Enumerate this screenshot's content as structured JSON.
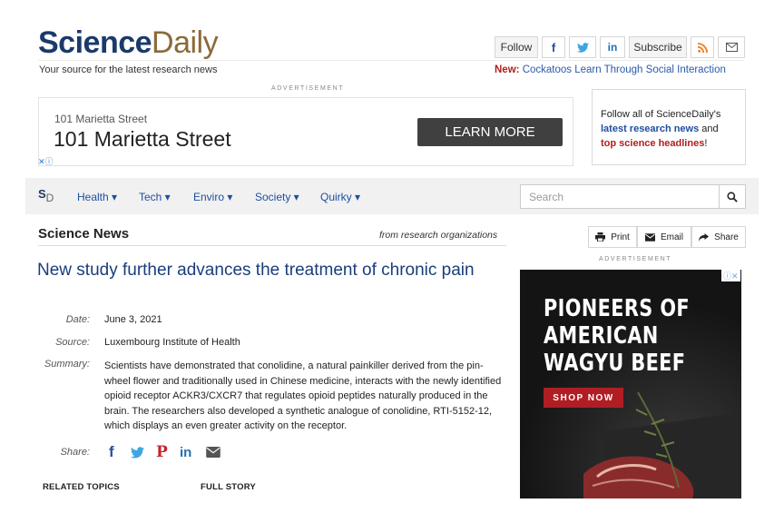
{
  "header": {
    "logo_part1": "Science",
    "logo_part2": "Daily",
    "tagline": "Your source for the latest research news",
    "follow_label": "Follow",
    "subscribe_label": "Subscribe",
    "new_label": "New:",
    "new_text": "Cockatoos Learn Through Social Interaction"
  },
  "top_ad": {
    "label": "ADVERTISEMENT",
    "small_text": "101 Marietta Street",
    "big_text": "101 Marietta Street",
    "button": "LEARN MORE"
  },
  "follow_box": {
    "line1": "Follow all of ScienceDaily's",
    "link1": "latest research news",
    "and": " and",
    "link2": "top science headlines",
    "end": "!"
  },
  "nav": {
    "logo_s": "S",
    "logo_d": "D",
    "items": [
      "Health ▾",
      "Tech ▾",
      "Enviro ▾",
      "Society ▾",
      "Quirky ▾"
    ],
    "search_placeholder": "Search"
  },
  "section": {
    "title": "Science News",
    "subtitle": "from research organizations"
  },
  "article": {
    "headline": "New study further advances the treatment of chronic pain",
    "date_label": "Date:",
    "date": "June 3, 2021",
    "source_label": "Source:",
    "source": "Luxembourg Institute of Health",
    "summary_label": "Summary:",
    "summary": "Scientists have demonstrated that conolidine, a natural painkiller derived from the pin-wheel flower and traditionally used in Chinese medicine, interacts with the newly identified opioid receptor ACKR3/CXCR7 that regulates opioid peptides naturally produced in the brain. The researchers also developed a synthetic analogue of conolidine, RTI-5152-12, which displays an even greater activity on the receptor.",
    "share_label": "Share:",
    "related_topics": "RELATED TOPICS",
    "full_story": "FULL STORY"
  },
  "tools": {
    "print": "Print",
    "email": "Email",
    "share": "Share"
  },
  "side_ad": {
    "label": "ADVERTISEMENT",
    "line1": "PIONEERS OF",
    "line2": "AMERICAN",
    "line3": "WAGYU BEEF",
    "button": "SHOP NOW"
  },
  "colors": {
    "brand_blue": "#1a3a6b",
    "link_blue": "#1f4ea0",
    "accent_red": "#b01e1e",
    "ad_dark": "#141414"
  }
}
